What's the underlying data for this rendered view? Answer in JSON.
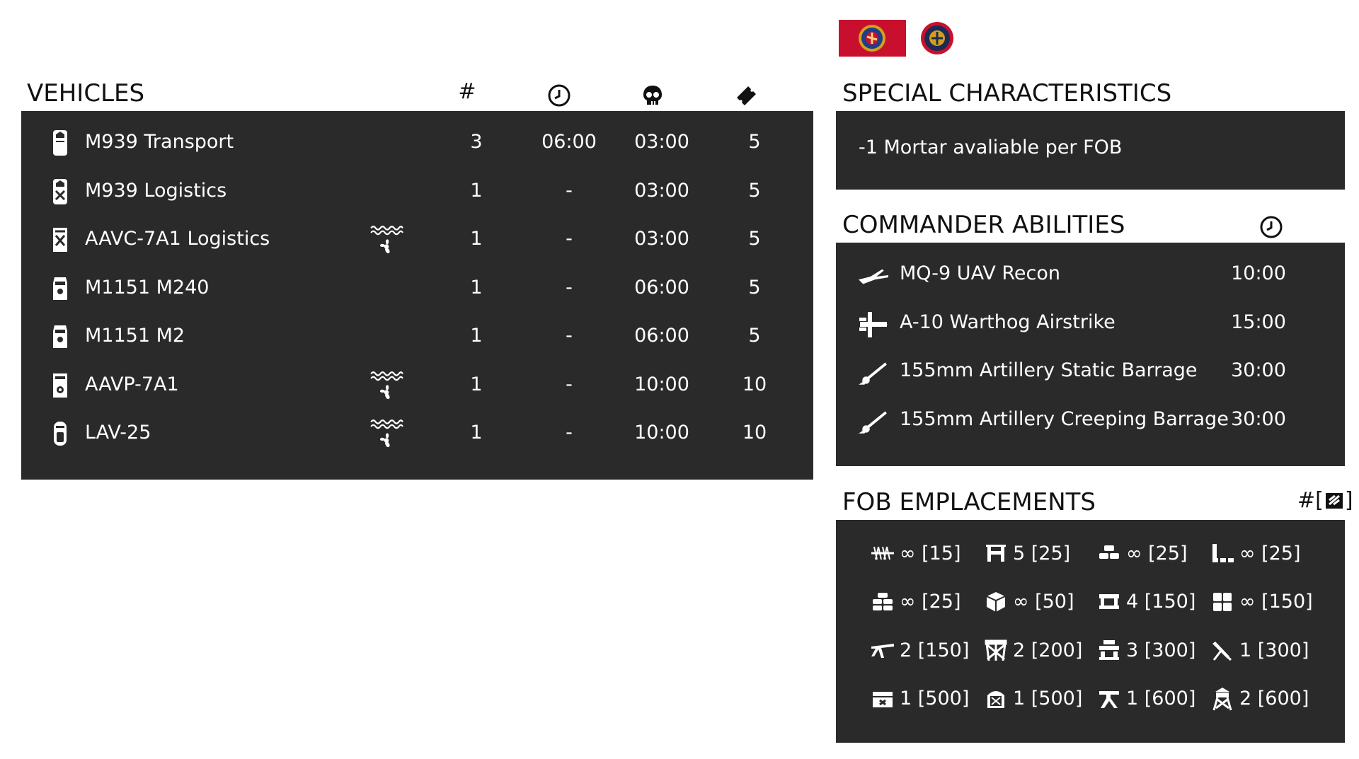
{
  "header": {
    "flag_icon": "usmc-flag-icon",
    "emblem_icon": "usmc-emblem-icon",
    "flag_color": "#c8102e"
  },
  "vehicles": {
    "title": "VEHICLES",
    "col_count": "#",
    "col_respawn_icon": "clock-icon",
    "col_destroy_icon": "skull-icon",
    "col_tickets_icon": "ticket-icon",
    "rows": [
      {
        "name": "M939 Transport",
        "icon": "truck-transport-icon",
        "amphibious": false,
        "count": "3",
        "respawn": "06:00",
        "destroy": "03:00",
        "tickets": "5"
      },
      {
        "name": "M939 Logistics",
        "icon": "truck-logistics-icon",
        "amphibious": false,
        "count": "1",
        "respawn": "-",
        "destroy": "03:00",
        "tickets": "5"
      },
      {
        "name": "AAVC-7A1 Logistics",
        "icon": "apc-logistics-icon",
        "amphibious": true,
        "count": "1",
        "respawn": "-",
        "destroy": "03:00",
        "tickets": "5"
      },
      {
        "name": "M1151 M240",
        "icon": "jeep-icon",
        "amphibious": false,
        "count": "1",
        "respawn": "-",
        "destroy": "06:00",
        "tickets": "5"
      },
      {
        "name": "M1151 M2",
        "icon": "jeep-icon",
        "amphibious": false,
        "count": "1",
        "respawn": "-",
        "destroy": "06:00",
        "tickets": "5"
      },
      {
        "name": "AAVP-7A1",
        "icon": "apc-icon",
        "amphibious": true,
        "count": "1",
        "respawn": "-",
        "destroy": "10:00",
        "tickets": "10"
      },
      {
        "name": "LAV-25",
        "icon": "ifv-icon",
        "amphibious": true,
        "count": "1",
        "respawn": "-",
        "destroy": "10:00",
        "tickets": "10"
      }
    ]
  },
  "special": {
    "title": "SPECIAL CHARACTERISTICS",
    "text": "-1 Mortar avaliable per FOB"
  },
  "commander": {
    "title": "COMMANDER ABILITIES",
    "col_icon": "clock-icon",
    "rows": [
      {
        "name": "MQ-9 UAV Recon",
        "icon": "uav-icon",
        "time": "10:00"
      },
      {
        "name": "A-10 Warthog Airstrike",
        "icon": "jet-icon",
        "time": "15:00"
      },
      {
        "name": "155mm Artillery Static Barrage",
        "icon": "artillery-icon",
        "time": "30:00"
      },
      {
        "name": "155mm Artillery Creeping Barrage",
        "icon": "artillery-icon",
        "time": "30:00"
      }
    ]
  },
  "fob": {
    "title": "FOB EMPLACEMENTS",
    "col_label": "#[",
    "col_label_end": "]",
    "col_icon": "construction-icon",
    "items": [
      {
        "icon": "razorwire-icon",
        "text": "∞ [15]"
      },
      {
        "icon": "hesco-icon",
        "text": "5 [25]"
      },
      {
        "icon": "sandbag-icon",
        "text": "∞ [25]"
      },
      {
        "icon": "wall-corner-icon",
        "text": "∞ [25]"
      },
      {
        "icon": "sandbag-wall-icon",
        "text": "∞ [25]"
      },
      {
        "icon": "ammo-crate-icon",
        "text": "∞ [50]"
      },
      {
        "icon": "bunker-icon",
        "text": "4 [150]"
      },
      {
        "icon": "barrier-block-icon",
        "text": "∞ [150]"
      },
      {
        "icon": "machine-gun-icon",
        "text": "2 [150]"
      },
      {
        "icon": "tower-frame-icon",
        "text": "2 [200]"
      },
      {
        "icon": "bunker-stack-icon",
        "text": "3 [300]"
      },
      {
        "icon": "mortar-icon",
        "text": "1 [300]"
      },
      {
        "icon": "ammo-bunker-icon",
        "text": "1 [500]"
      },
      {
        "icon": "radio-hab-icon",
        "text": "1 [500]"
      },
      {
        "icon": "at-gun-icon",
        "text": "1 [600]"
      },
      {
        "icon": "watchtower-icon",
        "text": "2 [600]"
      }
    ]
  }
}
